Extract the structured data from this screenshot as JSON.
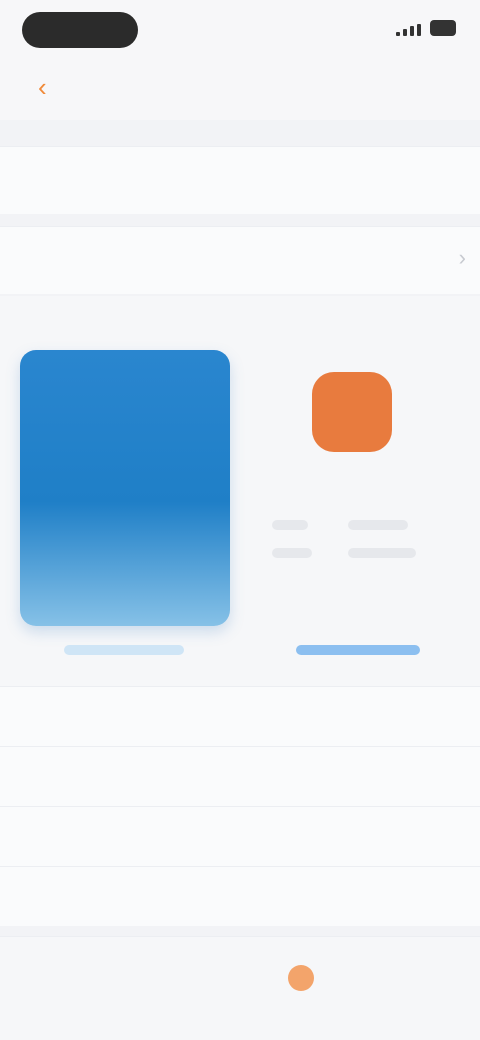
{
  "nav": {
    "back_icon": "chevron-left-icon",
    "title": "",
    "action_label": ""
  },
  "form": {
    "field1_label": "",
    "field2_label": ""
  },
  "options": {
    "left_title": "",
    "right_title": "",
    "blue_card_name": "",
    "blue_card_sub": "",
    "orange_logo_label": ""
  },
  "details": [
    {
      "key": "",
      "value": ""
    },
    {
      "key": "",
      "value": ""
    },
    {
      "key": "",
      "value": ""
    },
    {
      "key": "",
      "value": ""
    }
  ],
  "bottom": {
    "left": "",
    "middle": "",
    "right": "",
    "corner": ""
  },
  "colors": {
    "accent": "#f08a3a",
    "blue": "#1f7fc7",
    "orange": "#e87b3e"
  }
}
